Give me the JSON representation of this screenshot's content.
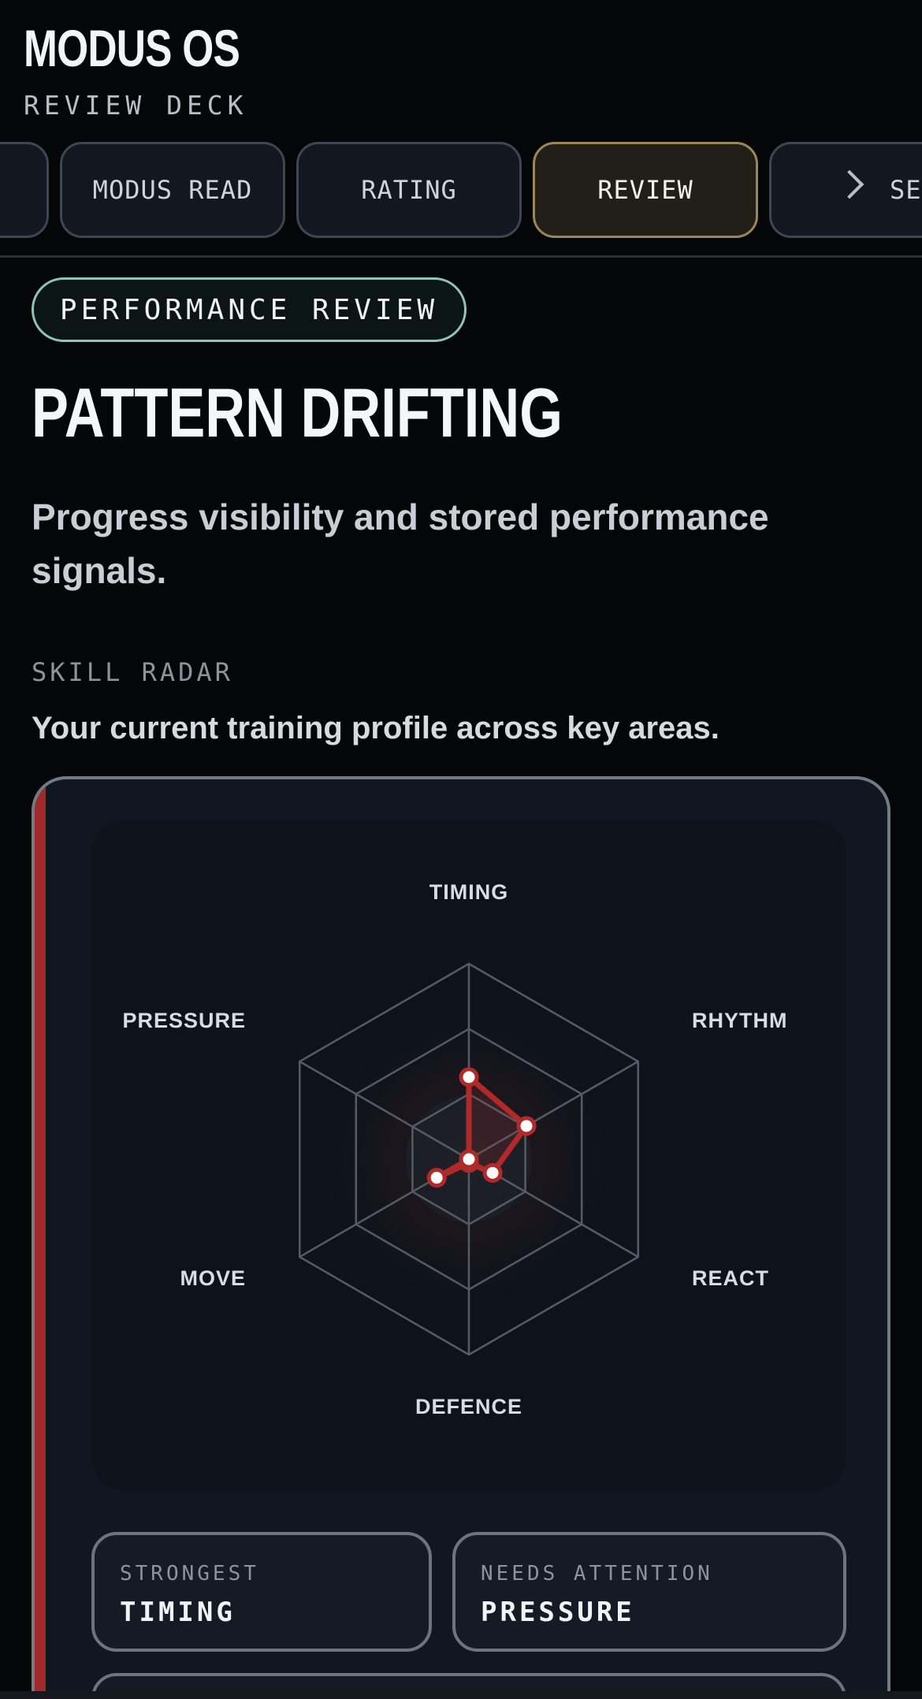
{
  "header": {
    "title": "MODUS OS",
    "subtitle": "REVIEW DECK"
  },
  "tabs": [
    {
      "label": ""
    },
    {
      "label": "MODUS READ"
    },
    {
      "label": "RATING"
    },
    {
      "label": "REVIEW",
      "active": true
    },
    {
      "label": "SER"
    }
  ],
  "section": {
    "chip": "PERFORMANCE REVIEW",
    "title": "PATTERN DRIFTING",
    "description": "Progress visibility and stored performance signals."
  },
  "radar": {
    "label": "SKILL RADAR",
    "description": "Your current training profile across key areas."
  },
  "chart_data": {
    "type": "radar",
    "axes": [
      "TIMING",
      "RHYTHM",
      "REACT",
      "DEFENCE",
      "MOVE",
      "PRESSURE"
    ],
    "values": [
      0.42,
      0.34,
      0.14,
      0.02,
      0.19,
      0.0
    ],
    "rings": 3,
    "range": [
      0,
      1
    ],
    "colors": {
      "series": "#b02a2a",
      "grid": "#555c67"
    }
  },
  "stats": {
    "strongest_label": "STRONGEST",
    "strongest_value": "TIMING",
    "attention_label": "NEEDS ATTENTION",
    "attention_value": "PRESSURE"
  },
  "colors": {
    "background": "#050608",
    "accent_red": "#a02a2a",
    "active_tab_border": "#9a8658",
    "chip_border": "#8fc4bb"
  }
}
